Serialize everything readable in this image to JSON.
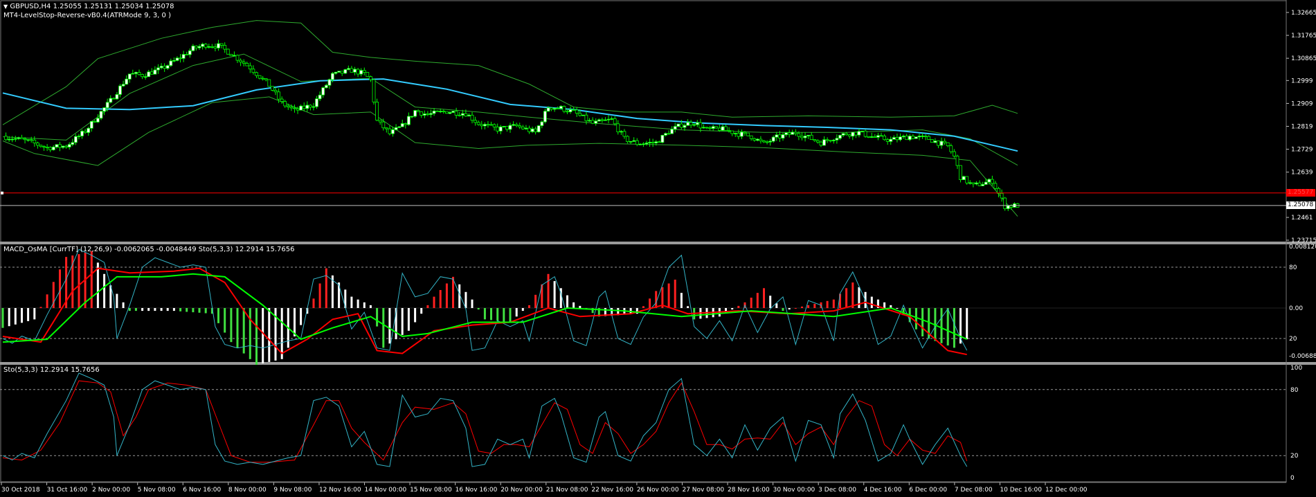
{
  "header": {
    "symbol_line": "GBPUSD,H4  1.25055 1.25131 1.25034 1.25078",
    "indicator_line": "MT4-LevelStop-Reverse-vB0.4(ATRMode 9, 3, 0 )"
  },
  "panels": {
    "macd_title": "MACD_OsMA [CurrTF] (12,26,9) -0.0062065 -0.0048449  Sto(5,3,3) 12.2914 15.7656",
    "stoch_title": "Sto(5,3,3) 12.2914 15.7656"
  },
  "colors": {
    "background": "#000000",
    "bull_candle": "#ffffff",
    "bear_candle": "#000000",
    "candle_wick": "#00ff00",
    "bollinger": "#2eaa2e",
    "moving_average": "#33ccff",
    "stop_level": "#ff0000",
    "current_price_line": "#c0c0c0",
    "histogram_positive_up": "#ff2020",
    "histogram_positive_down": "#ffffff",
    "histogram_negative_down": "#40e040",
    "histogram_negative_up": "#ffffff",
    "macd_line": "#00ff00",
    "signal_line": "#ff0000",
    "stoch_main": "#33b5c8",
    "stoch_signal": "#ff0000"
  },
  "chart_data": [
    {
      "type": "candlestick",
      "symbol": "GBPUSD",
      "timeframe": "H4",
      "ohlc_last": {
        "open": 1.25055,
        "high": 1.25131,
        "low": 1.25034,
        "close": 1.25078
      },
      "y_ticks": [
        1.32665,
        1.31765,
        1.30865,
        1.2999,
        1.2909,
        1.2819,
        1.2729,
        1.2639,
        1.2461,
        1.23715
      ],
      "ylim": [
        1.23715,
        1.32665
      ],
      "current_price_label": "1.25078",
      "stop_level_label": "1.25577",
      "stop_level": 1.2557,
      "x_labels": [
        "30 Oct 2018",
        "31 Oct 16:00",
        "2 Nov 00:00",
        "5 Nov 08:00",
        "6 Nov 16:00",
        "8 Nov 00:00",
        "9 Nov 08:00",
        "12 Nov 16:00",
        "14 Nov 00:00",
        "15 Nov 08:00",
        "16 Nov 16:00",
        "20 Nov 00:00",
        "21 Nov 08:00",
        "22 Nov 16:00",
        "26 Nov 00:00",
        "27 Nov 08:00",
        "28 Nov 16:00",
        "30 Nov 00:00",
        "3 Dec 08:00",
        "4 Dec 16:00",
        "6 Dec 00:00",
        "7 Dec 08:00",
        "10 Dec 16:00",
        "12 Dec 00:00"
      ],
      "close_path": [
        [
          0,
          1.278
        ],
        [
          8,
          1.276
        ],
        [
          14,
          1.2735
        ],
        [
          20,
          1.2742
        ],
        [
          26,
          1.28
        ],
        [
          34,
          1.292
        ],
        [
          40,
          1.3025
        ],
        [
          44,
          1.302
        ],
        [
          50,
          1.3045
        ],
        [
          56,
          1.309
        ],
        [
          60,
          1.3125
        ],
        [
          64,
          1.314
        ],
        [
          68,
          1.3135
        ],
        [
          72,
          1.3105
        ],
        [
          78,
          1.305
        ],
        [
          84,
          1.298
        ],
        [
          88,
          1.291
        ],
        [
          92,
          1.288
        ],
        [
          98,
          1.2905
        ],
        [
          104,
          1.302
        ],
        [
          110,
          1.304
        ],
        [
          114,
          1.3025
        ],
        [
          116,
          1.3
        ],
        [
          118,
          1.284
        ],
        [
          122,
          1.279
        ],
        [
          126,
          1.282
        ],
        [
          130,
          1.288
        ],
        [
          134,
          1.2865
        ],
        [
          140,
          1.2878
        ],
        [
          146,
          1.287
        ],
        [
          150,
          1.283
        ],
        [
          156,
          1.2808
        ],
        [
          162,
          1.282
        ],
        [
          168,
          1.2795
        ],
        [
          172,
          1.2895
        ],
        [
          176,
          1.289
        ],
        [
          180,
          1.2875
        ],
        [
          186,
          1.283
        ],
        [
          192,
          1.2845
        ],
        [
          196,
          1.277
        ],
        [
          200,
          1.2752
        ],
        [
          206,
          1.2755
        ],
        [
          210,
          1.2798
        ],
        [
          214,
          1.2825
        ],
        [
          218,
          1.2835
        ],
        [
          222,
          1.2805
        ],
        [
          226,
          1.281
        ],
        [
          232,
          1.279
        ],
        [
          236,
          1.278
        ],
        [
          240,
          1.275
        ],
        [
          244,
          1.2775
        ],
        [
          250,
          1.2795
        ],
        [
          254,
          1.2775
        ],
        [
          258,
          1.2755
        ],
        [
          262,
          1.2775
        ],
        [
          266,
          1.279
        ],
        [
          270,
          1.2795
        ],
        [
          274,
          1.2778
        ],
        [
          280,
          1.2765
        ],
        [
          286,
          1.278
        ],
        [
          292,
          1.277
        ],
        [
          298,
          1.274
        ],
        [
          300,
          1.27
        ],
        [
          302,
          1.262
        ],
        [
          306,
          1.2585
        ],
        [
          312,
          1.2605
        ],
        [
          316,
          1.2505
        ],
        [
          320,
          1.2508
        ]
      ],
      "moving_average_path": [
        [
          0,
          1.295
        ],
        [
          20,
          1.289
        ],
        [
          40,
          1.2885
        ],
        [
          60,
          1.29
        ],
        [
          80,
          1.2962
        ],
        [
          100,
          1.2998
        ],
        [
          120,
          1.3005
        ],
        [
          140,
          1.2965
        ],
        [
          160,
          1.2905
        ],
        [
          180,
          1.2885
        ],
        [
          200,
          1.285
        ],
        [
          220,
          1.2832
        ],
        [
          240,
          1.2822
        ],
        [
          260,
          1.2815
        ],
        [
          280,
          1.2805
        ],
        [
          300,
          1.278
        ],
        [
          320,
          1.2722
        ]
      ],
      "bollinger_upper": [
        [
          0,
          1.2825
        ],
        [
          20,
          1.2975
        ],
        [
          30,
          1.3085
        ],
        [
          50,
          1.3165
        ],
        [
          66,
          1.3208
        ],
        [
          80,
          1.3235
        ],
        [
          94,
          1.3225
        ],
        [
          104,
          1.311
        ],
        [
          116,
          1.309
        ],
        [
          130,
          1.3075
        ],
        [
          150,
          1.3058
        ],
        [
          166,
          1.2985
        ],
        [
          180,
          1.2895
        ],
        [
          196,
          1.2875
        ],
        [
          214,
          1.2875
        ],
        [
          230,
          1.2855
        ],
        [
          254,
          1.286
        ],
        [
          280,
          1.2855
        ],
        [
          300,
          1.286
        ],
        [
          312,
          1.2902
        ],
        [
          320,
          1.287
        ]
      ],
      "bollinger_middle": [
        [
          0,
          1.2778
        ],
        [
          20,
          1.2765
        ],
        [
          40,
          1.2948
        ],
        [
          60,
          1.3058
        ],
        [
          76,
          1.3103
        ],
        [
          94,
          1.2995
        ],
        [
          116,
          1.3008
        ],
        [
          130,
          1.2895
        ],
        [
          150,
          1.2875
        ],
        [
          166,
          1.2855
        ],
        [
          188,
          1.283
        ],
        [
          214,
          1.2805
        ],
        [
          240,
          1.2795
        ],
        [
          266,
          1.2795
        ],
        [
          290,
          1.2805
        ],
        [
          305,
          1.277
        ],
        [
          320,
          1.2666
        ]
      ],
      "bollinger_lower": [
        [
          0,
          1.2762
        ],
        [
          10,
          1.2712
        ],
        [
          30,
          1.2665
        ],
        [
          46,
          1.2795
        ],
        [
          66,
          1.2912
        ],
        [
          84,
          1.2935
        ],
        [
          98,
          1.2865
        ],
        [
          116,
          1.2875
        ],
        [
          130,
          1.2755
        ],
        [
          150,
          1.2732
        ],
        [
          166,
          1.2745
        ],
        [
          188,
          1.2752
        ],
        [
          214,
          1.2745
        ],
        [
          240,
          1.2735
        ],
        [
          266,
          1.2718
        ],
        [
          290,
          1.2705
        ],
        [
          305,
          1.2685
        ],
        [
          320,
          1.2465
        ]
      ]
    },
    {
      "type": "histogram_with_lines",
      "name": "MACD_OsMA [CurrTF] (12,26,9)",
      "values_text": [
        "-0.0062065",
        "-0.0048449"
      ],
      "ylim": [
        -0.006888,
        0.00812
      ],
      "y_ticks": [
        "0.008120",
        "80",
        "0.00",
        "20",
        "-0.006888"
      ],
      "levels": [
        80,
        20
      ]
    },
    {
      "type": "line",
      "name": "Sto(5,3,3)",
      "main_value": 12.2914,
      "signal_value": 15.7656,
      "ylim": [
        0,
        100
      ],
      "y_ticks": [
        "100",
        "80",
        "20",
        "0"
      ],
      "levels": [
        80,
        20
      ],
      "main_path": [
        [
          0,
          20
        ],
        [
          3,
          16
        ],
        [
          6,
          22
        ],
        [
          10,
          18
        ],
        [
          14,
          40
        ],
        [
          20,
          70
        ],
        [
          24,
          95
        ],
        [
          28,
          90
        ],
        [
          32,
          84
        ],
        [
          35,
          55
        ],
        [
          36,
          20
        ],
        [
          40,
          48
        ],
        [
          44,
          80
        ],
        [
          48,
          88
        ],
        [
          52,
          84
        ],
        [
          56,
          80
        ],
        [
          60,
          82
        ],
        [
          64,
          80
        ],
        [
          67,
          30
        ],
        [
          70,
          15
        ],
        [
          74,
          12
        ],
        [
          78,
          14
        ],
        [
          82,
          12
        ],
        [
          86,
          15
        ],
        [
          90,
          18
        ],
        [
          94,
          20
        ],
        [
          98,
          70
        ],
        [
          102,
          73
        ],
        [
          106,
          65
        ],
        [
          110,
          28
        ],
        [
          114,
          42
        ],
        [
          118,
          12
        ],
        [
          122,
          10
        ],
        [
          126,
          75
        ],
        [
          130,
          55
        ],
        [
          134,
          58
        ],
        [
          138,
          72
        ],
        [
          142,
          70
        ],
        [
          146,
          45
        ],
        [
          148,
          10
        ],
        [
          152,
          12
        ],
        [
          156,
          35
        ],
        [
          160,
          30
        ],
        [
          164,
          35
        ],
        [
          166,
          18
        ],
        [
          170,
          65
        ],
        [
          174,
          72
        ],
        [
          176,
          58
        ],
        [
          180,
          18
        ],
        [
          184,
          14
        ],
        [
          188,
          55
        ],
        [
          190,
          60
        ],
        [
          194,
          20
        ],
        [
          198,
          15
        ],
        [
          202,
          38
        ],
        [
          206,
          50
        ],
        [
          210,
          80
        ],
        [
          214,
          90
        ],
        [
          218,
          30
        ],
        [
          222,
          20
        ],
        [
          226,
          35
        ],
        [
          230,
          18
        ],
        [
          234,
          48
        ],
        [
          238,
          25
        ],
        [
          242,
          45
        ],
        [
          246,
          55
        ],
        [
          250,
          15
        ],
        [
          254,
          52
        ],
        [
          258,
          48
        ],
        [
          262,
          18
        ],
        [
          264,
          58
        ],
        [
          268,
          76
        ],
        [
          272,
          52
        ],
        [
          276,
          15
        ],
        [
          280,
          22
        ],
        [
          284,
          48
        ],
        [
          286,
          35
        ],
        [
          290,
          12
        ],
        [
          294,
          30
        ],
        [
          298,
          45
        ],
        [
          302,
          20
        ],
        [
          304,
          10
        ]
      ],
      "signal_path": [
        [
          0,
          18
        ],
        [
          6,
          16
        ],
        [
          12,
          25
        ],
        [
          18,
          50
        ],
        [
          24,
          88
        ],
        [
          30,
          86
        ],
        [
          34,
          78
        ],
        [
          38,
          38
        ],
        [
          42,
          55
        ],
        [
          46,
          80
        ],
        [
          52,
          86
        ],
        [
          58,
          84
        ],
        [
          64,
          80
        ],
        [
          68,
          50
        ],
        [
          72,
          20
        ],
        [
          78,
          14
        ],
        [
          84,
          14
        ],
        [
          92,
          16
        ],
        [
          98,
          48
        ],
        [
          102,
          70
        ],
        [
          106,
          70
        ],
        [
          110,
          45
        ],
        [
          114,
          32
        ],
        [
          120,
          16
        ],
        [
          126,
          50
        ],
        [
          130,
          64
        ],
        [
          136,
          62
        ],
        [
          142,
          68
        ],
        [
          146,
          58
        ],
        [
          150,
          24
        ],
        [
          154,
          22
        ],
        [
          158,
          30
        ],
        [
          162,
          30
        ],
        [
          166,
          28
        ],
        [
          170,
          48
        ],
        [
          174,
          68
        ],
        [
          178,
          62
        ],
        [
          182,
          30
        ],
        [
          186,
          22
        ],
        [
          190,
          50
        ],
        [
          194,
          40
        ],
        [
          198,
          22
        ],
        [
          202,
          30
        ],
        [
          206,
          42
        ],
        [
          210,
          68
        ],
        [
          214,
          86
        ],
        [
          218,
          60
        ],
        [
          222,
          30
        ],
        [
          226,
          30
        ],
        [
          230,
          26
        ],
        [
          234,
          35
        ],
        [
          238,
          36
        ],
        [
          242,
          35
        ],
        [
          246,
          50
        ],
        [
          250,
          30
        ],
        [
          254,
          40
        ],
        [
          258,
          46
        ],
        [
          262,
          30
        ],
        [
          266,
          55
        ],
        [
          270,
          70
        ],
        [
          274,
          65
        ],
        [
          278,
          30
        ],
        [
          282,
          20
        ],
        [
          286,
          35
        ],
        [
          290,
          25
        ],
        [
          294,
          22
        ],
        [
          298,
          38
        ],
        [
          302,
          32
        ],
        [
          304,
          15
        ]
      ]
    }
  ]
}
